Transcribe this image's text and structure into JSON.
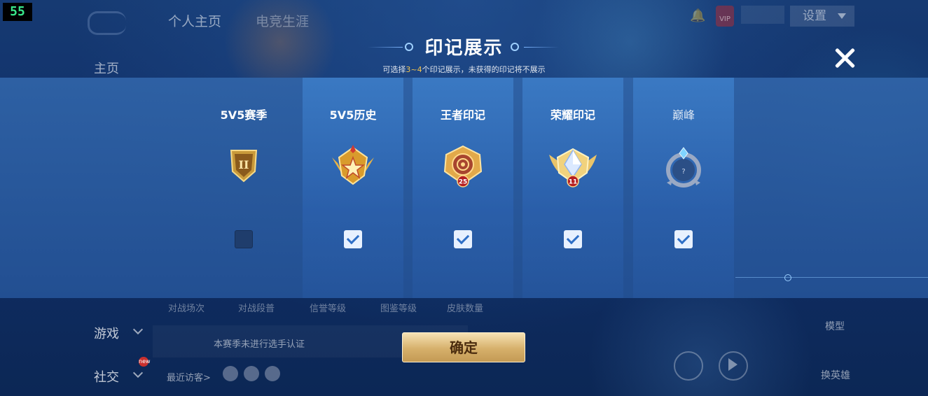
{
  "overlay": {
    "fps": "55"
  },
  "header": {
    "tabs": [
      "个人主页",
      "电竞生涯"
    ],
    "settings_label": "设置",
    "vip_label": "VIP",
    "icons": [
      "bell-icon",
      "chevron-down-icon"
    ]
  },
  "sidebar": {
    "home": "主页",
    "game": "游戏",
    "social": "社交",
    "social_badge": "new"
  },
  "background": {
    "stats": [
      "对战场次",
      "对战段普",
      "信誉等级",
      "图鉴等级",
      "皮肤数量"
    ],
    "cert_text": "本赛季未进行选手认证",
    "visitors_label": "最近访客>",
    "model_label": "模型",
    "swap_hero_label": "换英雄"
  },
  "modal": {
    "title": "印记展示",
    "subtitle_prefix": "可选择",
    "subtitle_range": "3~4",
    "subtitle_suffix": "个印记展示，未获得的印记将不展示",
    "confirm_label": "确定",
    "colors": {
      "accent_gold": "#f2c44e",
      "band": "#3064a8"
    },
    "marks": [
      {
        "label": "5V5赛季",
        "badge_icon": "season-rank-ii-badge-icon",
        "badge_text": "II",
        "checked": false
      },
      {
        "label": "5V5历史",
        "badge_icon": "history-star-badge-icon",
        "badge_text": "",
        "checked": true
      },
      {
        "label": "王者印记",
        "badge_icon": "king-mark-badge-icon",
        "badge_text": "25",
        "checked": true
      },
      {
        "label": "荣耀印记",
        "badge_icon": "glory-mark-badge-icon",
        "badge_text": "11",
        "checked": true
      },
      {
        "label": "巅峰",
        "badge_icon": "peak-badge-icon",
        "badge_text": "?",
        "checked": true
      }
    ]
  }
}
